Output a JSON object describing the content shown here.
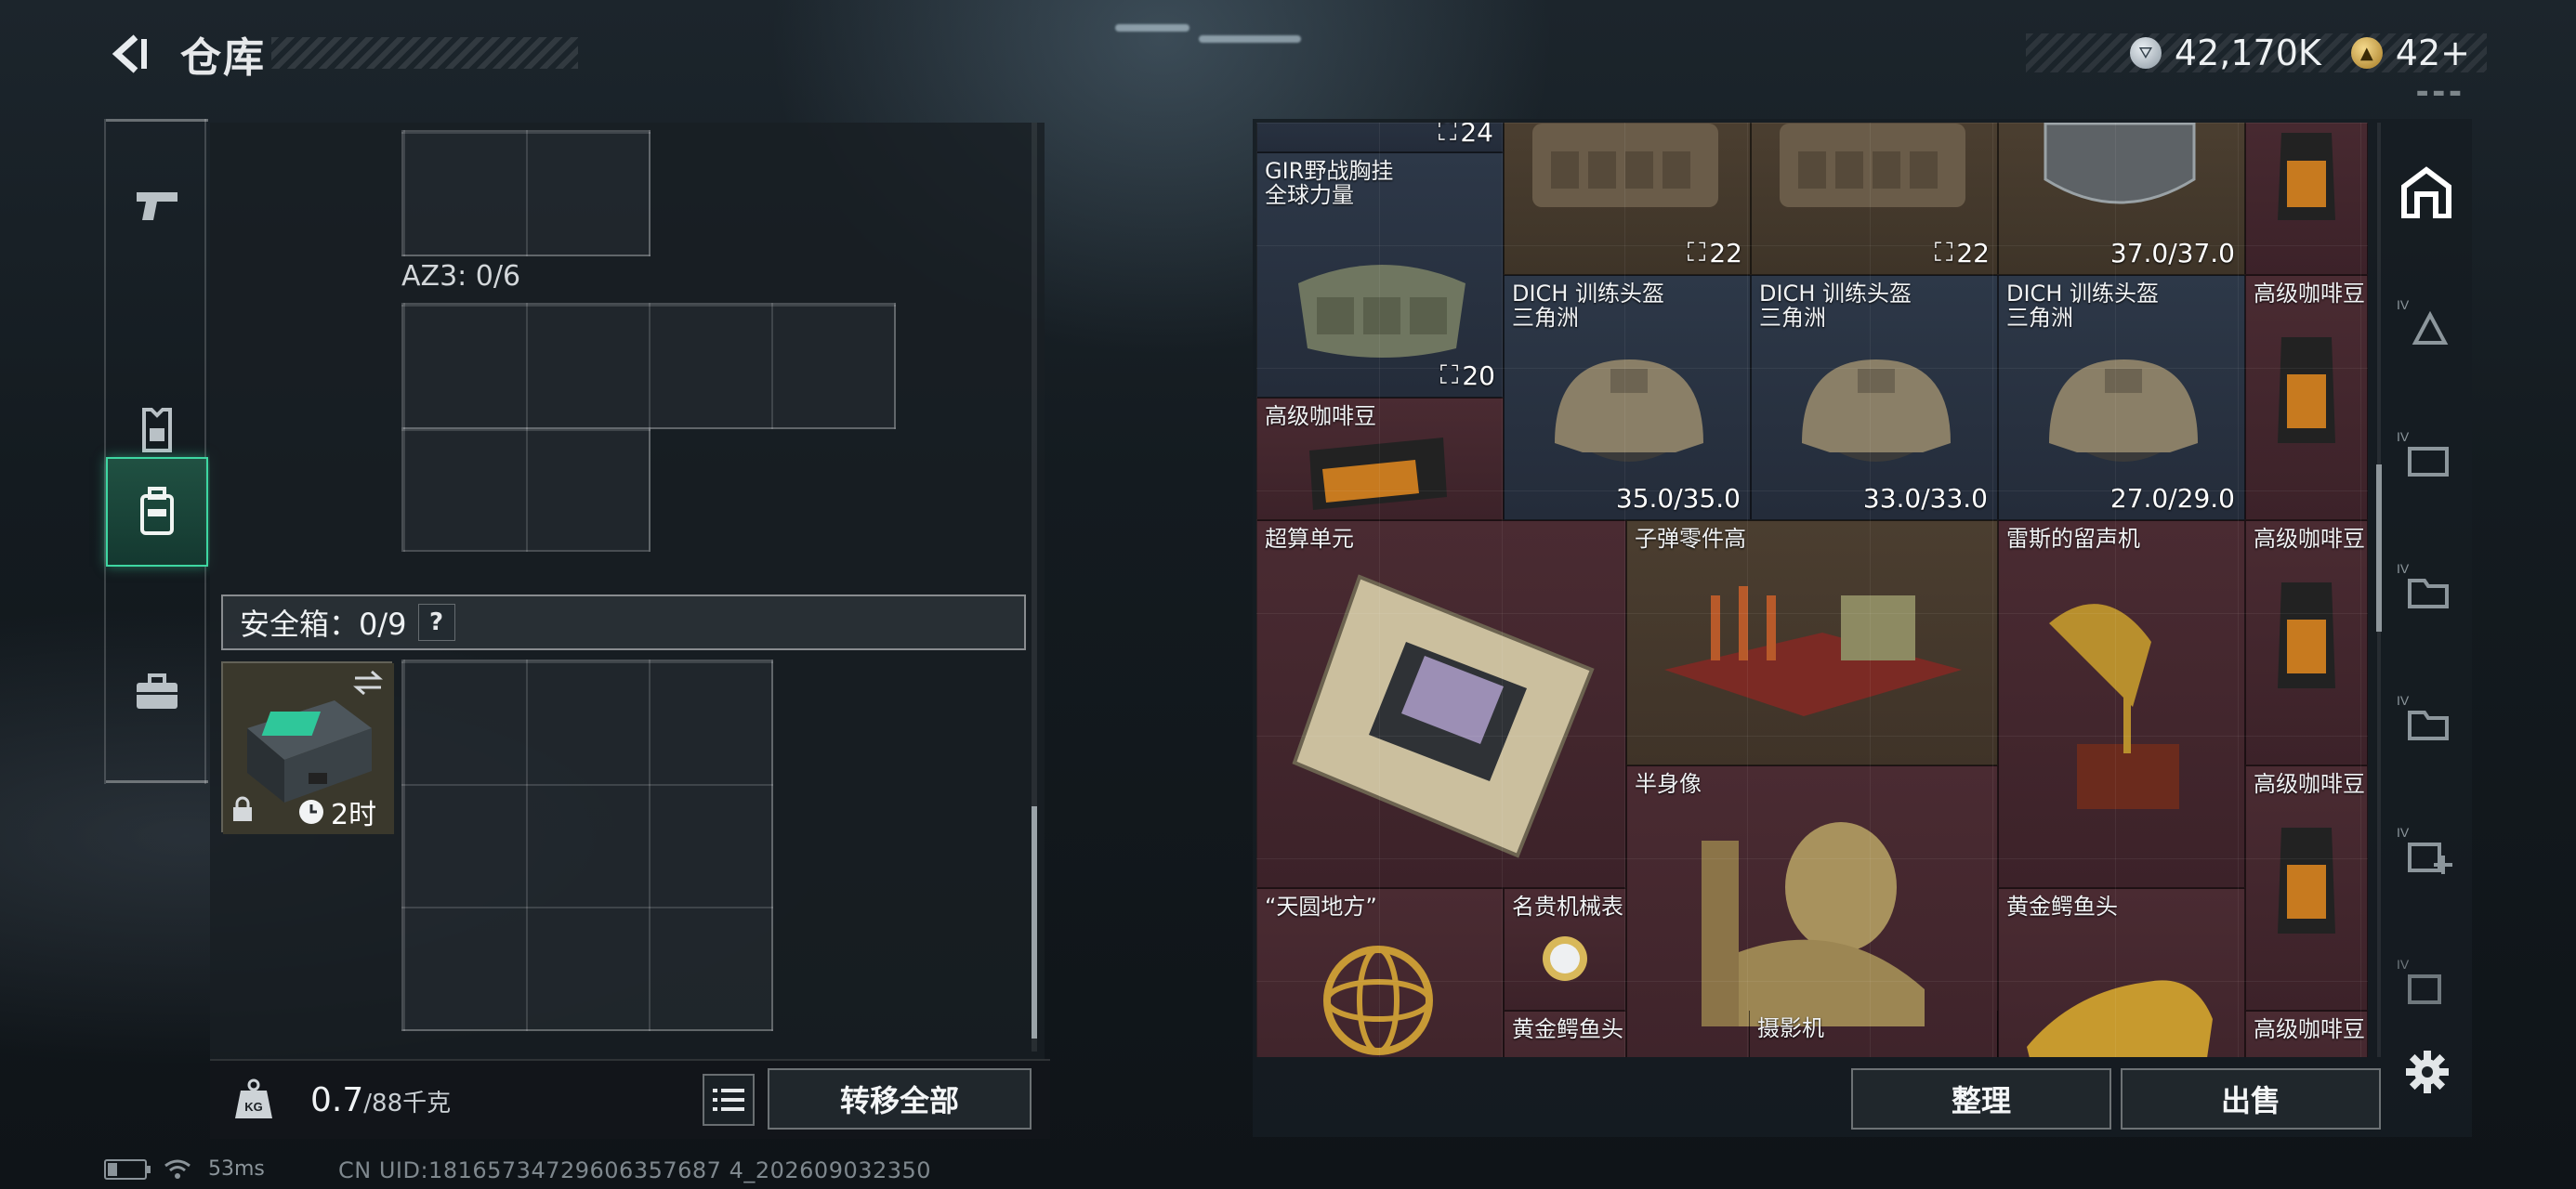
{
  "header": {
    "title": "仓库",
    "currency": [
      {
        "icon": "silver-coin-icon",
        "value": "42,170K"
      },
      {
        "icon": "gold-triangle-coin-icon",
        "value": "42+"
      }
    ]
  },
  "left": {
    "az3_label": "AZ3: 0/6",
    "safe_box_label": "安全箱：0/9",
    "help": "?",
    "safe_box_timer": "2时",
    "weight_value": "0.7",
    "weight_capacity": "/88千克",
    "weight_icon_text": "KG",
    "transfer_all": "转移全部"
  },
  "items": {
    "top_badge": "24",
    "chest_rig_name": "GIR野战胸挂\n全球力量",
    "chest_rig_badge": "20",
    "vest1_badge": "22",
    "vest2_badge": "22",
    "helmet_top_value": "37.0/37.0",
    "coffee": "高级咖啡豆",
    "helmet": "DICH 训练头盔\n三角洲",
    "helmet1_value": "35.0/35.0",
    "helmet2_value": "33.0/33.0",
    "helmet3_value": "27.0/29.0",
    "supercomputer": "超算单元",
    "bullet_parts": "子弹零件高",
    "gramophone": "雷斯的留声机",
    "bust": "半身像",
    "armillary": "“天圆地方”",
    "watch": "名贵机械表",
    "croc_head": "黄金鳄鱼头",
    "camera": "摄影机"
  },
  "actions": {
    "sort": "整理",
    "sell": "出售"
  },
  "status": {
    "ping": "53ms",
    "uid": "CN UID:18165734729606357687 4_202609032350"
  },
  "colors": {
    "accent_green": "#3ed7a2",
    "cell_blue": "#2d3848",
    "cell_red": "#4a2b32",
    "cell_brown": "#4e4132"
  }
}
